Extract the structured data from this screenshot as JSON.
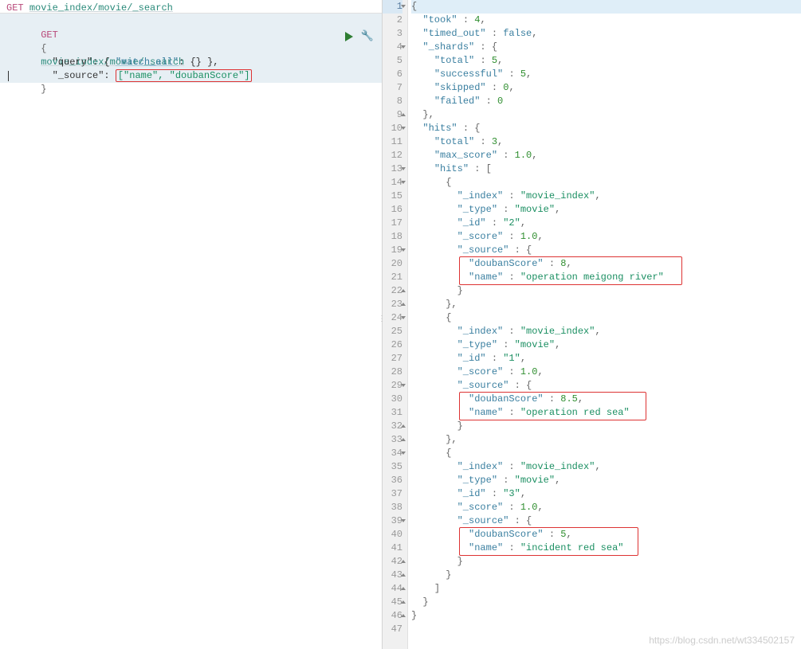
{
  "left": {
    "header_method": "GET",
    "header_path": "movie_index/movie/_search",
    "query_method": "GET",
    "query_path": "movie_index/movie/_search",
    "line3_part1": "  \"query\": { ",
    "line3_match_all": "\"match_all\"",
    "line3_part2": ": {} },",
    "line4_part1": "  \"_source\": ",
    "line4_source_arr": "[\"name\", \"doubanScore\"]",
    "line2_brace": "{",
    "line5_brace": "}"
  },
  "right_lines": {
    "l1": "{",
    "l2": "  \"took\" : 4,",
    "l3": "  \"timed_out\" : false,",
    "l4": "  \"_shards\" : {",
    "l5": "    \"total\" : 5,",
    "l6": "    \"successful\" : 5,",
    "l7": "    \"skipped\" : 0,",
    "l8": "    \"failed\" : 0",
    "l9": "  },",
    "l10": "  \"hits\" : {",
    "l11": "    \"total\" : 3,",
    "l12": "    \"max_score\" : 1.0,",
    "l13": "    \"hits\" : [",
    "l14": "      {",
    "l15": "        \"_index\" : \"movie_index\",",
    "l16": "        \"_type\" : \"movie\",",
    "l17": "        \"_id\" : \"2\",",
    "l18": "        \"_score\" : 1.0,",
    "l19": "        \"_source\" : {",
    "l20": "          \"doubanScore\" : 8,",
    "l21": "          \"name\" : \"operation meigong river\"",
    "l22": "        }",
    "l23": "      },",
    "l24": "      {",
    "l25": "        \"_index\" : \"movie_index\",",
    "l26": "        \"_type\" : \"movie\",",
    "l27": "        \"_id\" : \"1\",",
    "l28": "        \"_score\" : 1.0,",
    "l29": "        \"_source\" : {",
    "l30": "          \"doubanScore\" : 8.5,",
    "l31": "          \"name\" : \"operation red sea\"",
    "l32": "        }",
    "l33": "      },",
    "l34": "      {",
    "l35": "        \"_index\" : \"movie_index\",",
    "l36": "        \"_type\" : \"movie\",",
    "l37": "        \"_id\" : \"3\",",
    "l38": "        \"_score\" : 1.0,",
    "l39": "        \"_source\" : {",
    "l40": "          \"doubanScore\" : 5,",
    "l41": "          \"name\" : \"incident red sea\"",
    "l42": "        }",
    "l43": "      }",
    "l44": "    ]",
    "l45": "  }",
    "l46": "}",
    "l47": ""
  },
  "line_numbers": [
    "1",
    "2",
    "3",
    "4",
    "5",
    "6",
    "7",
    "8",
    "9",
    "10",
    "11",
    "12",
    "13",
    "14",
    "15",
    "16",
    "17",
    "18",
    "19",
    "20",
    "21",
    "22",
    "23",
    "24",
    "25",
    "26",
    "27",
    "28",
    "29",
    "30",
    "31",
    "32",
    "33",
    "34",
    "35",
    "36",
    "37",
    "38",
    "39",
    "40",
    "41",
    "42",
    "43",
    "44",
    "45",
    "46",
    "47"
  ],
  "watermark": "https://blog.csdn.net/wt334502157"
}
